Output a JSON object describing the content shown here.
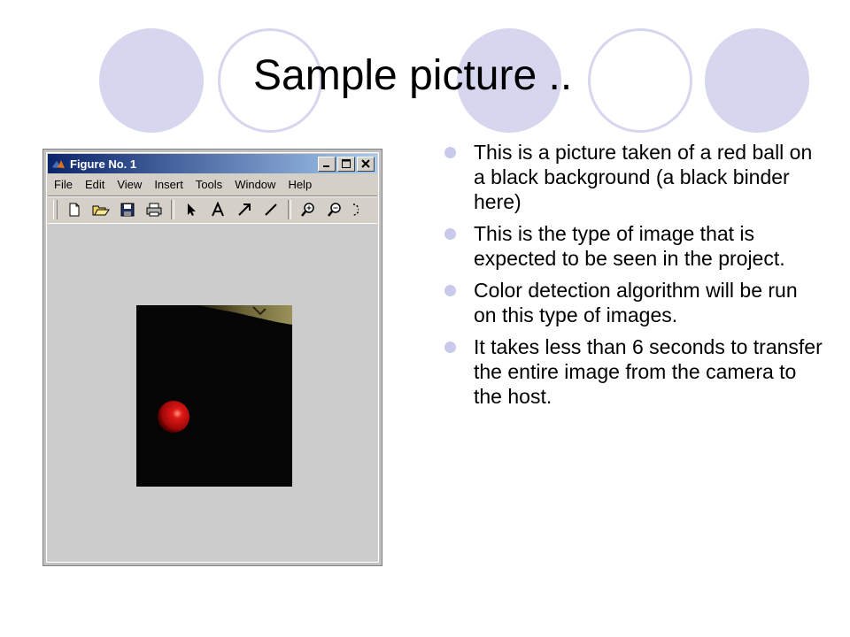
{
  "slide": {
    "title": "Sample picture ..",
    "bullets": [
      "This is a picture taken of a red ball on a black background (a black binder here)",
      "This is the type of image that is expected to be seen in the project.",
      "Color detection algorithm will be run on this type of images.",
      "It takes less than 6 seconds to transfer the entire image from the camera to the host."
    ]
  },
  "figure_window": {
    "title": "Figure No. 1",
    "menu": [
      "File",
      "Edit",
      "View",
      "Insert",
      "Tools",
      "Window",
      "Help"
    ],
    "toolbar_icons": [
      "new-file-icon",
      "open-folder-icon",
      "save-icon",
      "print-icon",
      "arrow-select-icon",
      "text-icon",
      "arrow-icon",
      "line-icon",
      "zoom-in-icon",
      "zoom-out-icon",
      "rotate-icon"
    ]
  },
  "colors": {
    "circle_fill": "#d6d6ee",
    "bullet": "#c9c9ec",
    "titlebar_start": "#0a246a",
    "titlebar_end": "#a6caf0",
    "ball": "#d01010"
  }
}
